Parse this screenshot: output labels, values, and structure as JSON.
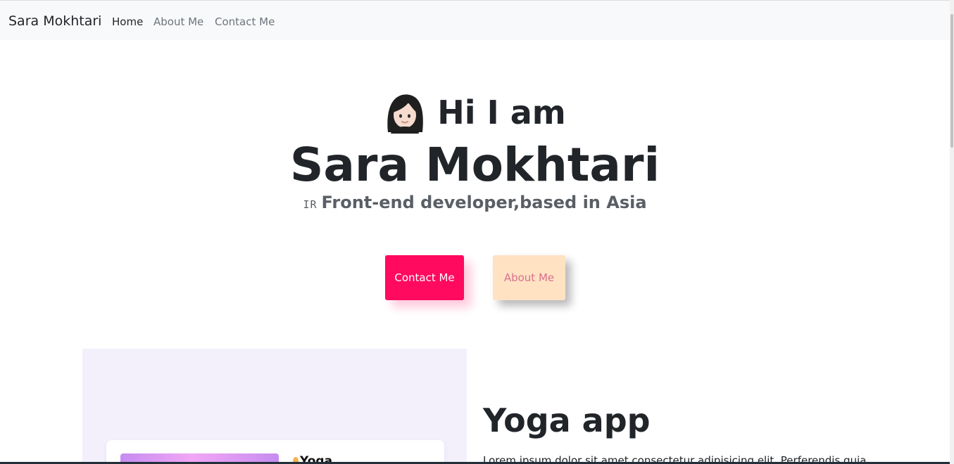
{
  "navbar": {
    "brand": "Sara Mokhtari",
    "links": [
      {
        "label": "Home",
        "active": true
      },
      {
        "label": "About Me",
        "active": false
      },
      {
        "label": "Contact Me",
        "active": false
      }
    ]
  },
  "hero": {
    "avatar_icon": "woman-light-skin-emoji",
    "greeting": "Hi I am",
    "name": "Sara Mokhtari",
    "flag_code": "IR",
    "tagline": "Front-end developer,based in Asia",
    "buttons": {
      "contact": "Contact Me",
      "about": "About Me"
    }
  },
  "project": {
    "mockup_logo": "Yoga",
    "title": "Yoga app",
    "description": "Lorem ipsum dolor sit amet consectetur adipisicing elit. Perferendis quia,"
  },
  "colors": {
    "primary_button": "#ff0a5f",
    "secondary_button": "#ffe2c2",
    "secondary_button_text": "#d87090",
    "navbar_bg": "#f8f9fa",
    "project_panel_bg": "#f3f0fc"
  }
}
